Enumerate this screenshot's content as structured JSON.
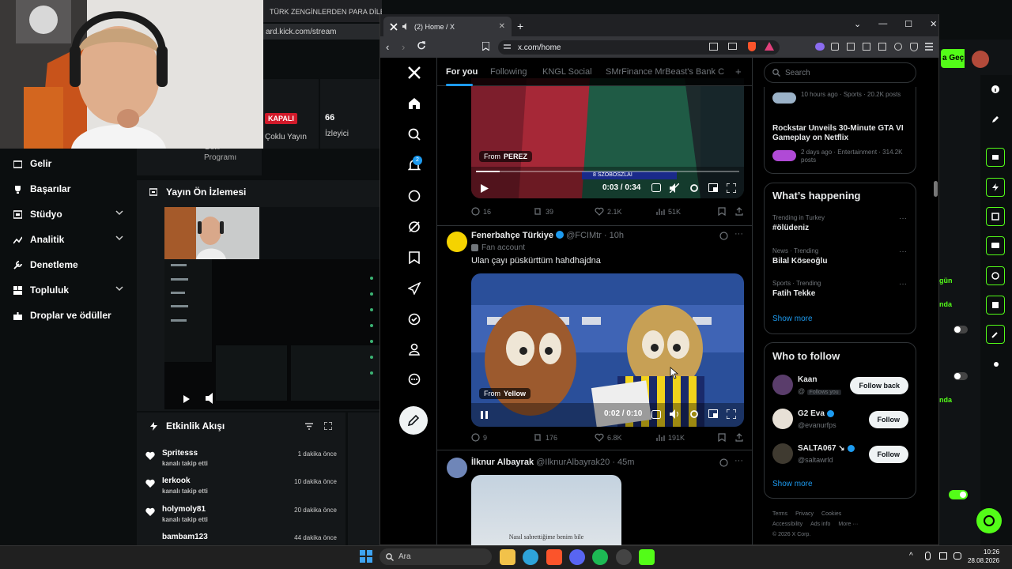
{
  "kick": {
    "browser_tab_title": "TÜRK ZENGİNLERDEN PARA DİLENE",
    "url": "ard.kick.com/stream",
    "status_badge": "KAPALI",
    "status_sub": "Çoklu Yayın",
    "viewers_value": "66",
    "viewers_label": "İzleyici",
    "gelir_programi": "Gelir Programı",
    "sidebar": [
      {
        "label": "Gelir",
        "chevron": false
      },
      {
        "label": "Başarılar",
        "chevron": false
      },
      {
        "label": "Stüdyo",
        "chevron": true
      },
      {
        "label": "Analitik",
        "chevron": true
      },
      {
        "label": "Denetleme",
        "chevron": false
      },
      {
        "label": "Topluluk",
        "chevron": true
      },
      {
        "label": "Droplar ve ödüller",
        "chevron": false
      }
    ],
    "preview_title": "Yayın Ön İzlemesi",
    "activity_title": "Etkinlik Akışı",
    "activity": [
      {
        "name": "Spritesss",
        "sub": "kanalı takip etti",
        "time": "1 dakika önce"
      },
      {
        "name": "Ierkook",
        "sub": "kanalı takip etti",
        "time": "10 dakika önce"
      },
      {
        "name": "holymoly81",
        "sub": "kanalı takip etti",
        "time": "20 dakika önce"
      },
      {
        "name": "bambam123",
        "sub": "",
        "time": "44 dakika önce"
      }
    ],
    "right_texts": [
      "a Geç",
      "gün",
      "nda",
      "nda"
    ],
    "accent": "#53fc18"
  },
  "chrome": {
    "tab_title": "(2) Home / X",
    "url": "x.com/home"
  },
  "x": {
    "tabs": [
      "For you",
      "Following",
      "KNGL Social",
      "SMrFinance MrBeast's Bank CTO"
    ],
    "notification_count": "2",
    "post1": {
      "from_label": "From",
      "from_name": "PEREZ",
      "time": "0:03 / 0:34",
      "progress": 0.09,
      "overlay_text": "8 SZOBOSZLAI",
      "replies": "16",
      "reposts": "39",
      "likes": "2.1K",
      "views": "51K"
    },
    "post2": {
      "name": "Fenerbahçe Türkiye",
      "handle": "@FCIMtr",
      "age": "10h",
      "badge": "Fan account",
      "text": "Ulan çayı püskürttüm hahdhajdna",
      "from_label": "From",
      "from_name": "Yellow",
      "time": "0:02 / 0:10",
      "replies": "9",
      "reposts": "176",
      "likes": "6.8K",
      "views": "191K"
    },
    "post3": {
      "name": "İlknur Albayrak",
      "handle": "@IlknurAlbayrak20",
      "age": "45m",
      "caption": "Nasıl sabrettiğime benim bile"
    },
    "search_placeholder": "Search",
    "trend_top": [
      {
        "meta": "10 hours ago · Sports · 20.2K posts",
        "title": ""
      },
      {
        "meta": "2 days ago · Entertainment · 314.2K posts",
        "title": "Rockstar Unveils 30-Minute GTA VI Gameplay on Netflix"
      }
    ],
    "whats_happening": "What’s happening",
    "trends": [
      {
        "meta": "Trending in Turkey",
        "title": "#ölüdeniz"
      },
      {
        "meta": "News · Trending",
        "title": "Bilal Köseoğlu"
      },
      {
        "meta": "Sports · Trending",
        "title": "Fatih Tekke"
      }
    ],
    "show_more": "Show more",
    "who_to_follow": "Who to follow",
    "who": [
      {
        "name": "Kaan",
        "handle": "@",
        "note": "Follows you",
        "button": "Follow back",
        "verified": false
      },
      {
        "name": "G2 Eva",
        "handle": "@evanurfps",
        "note": "",
        "button": "Follow",
        "verified": true
      },
      {
        "name": "SALTA067 ↘",
        "handle": "@saltawrld",
        "note": "",
        "button": "Follow",
        "verified": true
      }
    ],
    "footer": [
      "Terms",
      "Privacy",
      "Cookies",
      "Accessibility",
      "Ads info",
      "More ···",
      "© 2026 X Corp."
    ],
    "accent": "#1d9bf0"
  },
  "taskbar": {
    "search_placeholder": "Ara",
    "time": "10:26",
    "date": "28.08.2026"
  }
}
